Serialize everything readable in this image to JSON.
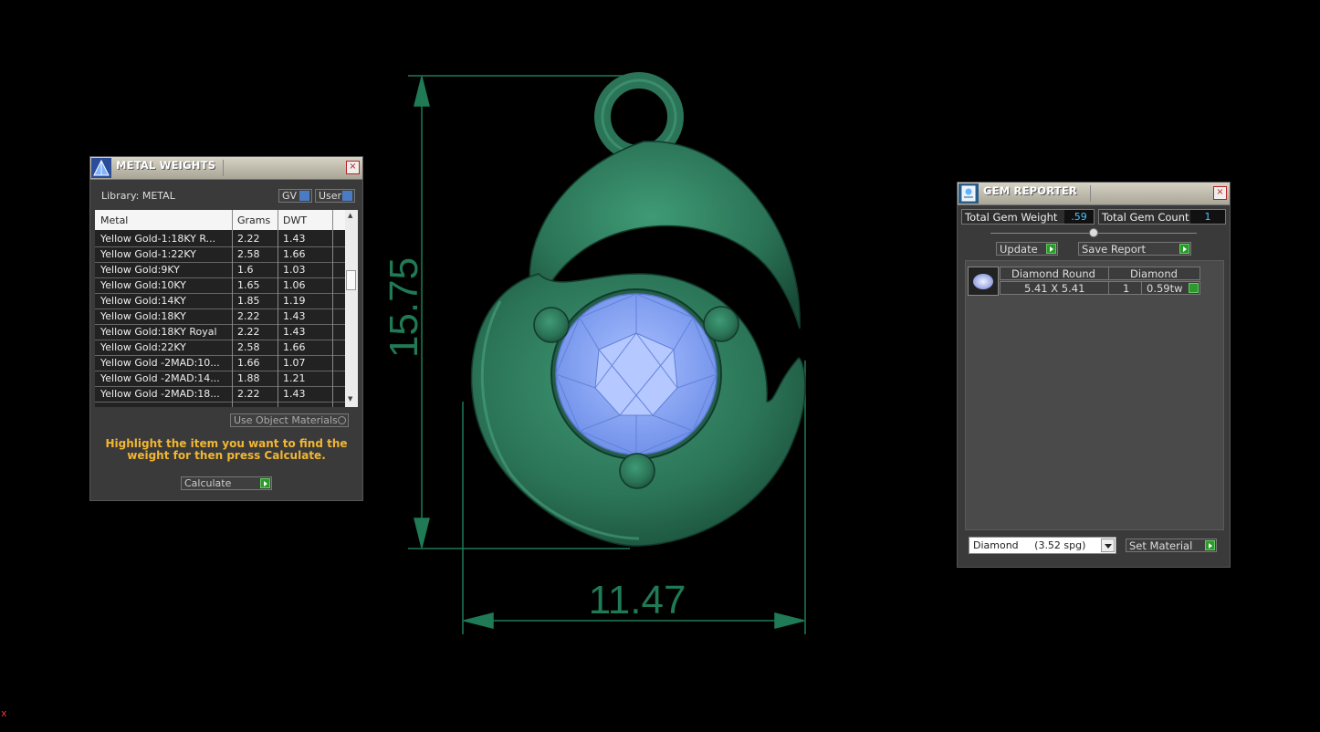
{
  "metal_weights": {
    "title": "METAL WEIGHTS",
    "close": "×",
    "library_label": "Library: METAL",
    "gv_label": "GV",
    "user_label": "User",
    "columns": [
      "Metal",
      "Grams",
      "DWT"
    ],
    "rows": [
      [
        "Yellow Gold-1:18KY R...",
        "2.22",
        "1.43"
      ],
      [
        "Yellow Gold-1:22KY",
        "2.58",
        "1.66"
      ],
      [
        "Yellow Gold:9KY",
        "1.6",
        "1.03"
      ],
      [
        "Yellow Gold:10KY",
        "1.65",
        "1.06"
      ],
      [
        "Yellow Gold:14KY",
        "1.85",
        "1.19"
      ],
      [
        "Yellow Gold:18KY",
        "2.22",
        "1.43"
      ],
      [
        "Yellow Gold:18KY Royal",
        "2.22",
        "1.43"
      ],
      [
        "Yellow Gold:22KY",
        "2.58",
        "1.66"
      ],
      [
        "Yellow Gold -2MAD:10...",
        "1.66",
        "1.07"
      ],
      [
        "Yellow Gold -2MAD:14...",
        "1.88",
        "1.21"
      ],
      [
        "Yellow Gold -2MAD:18...",
        "2.22",
        "1.43"
      ]
    ],
    "scroll_up": "▲",
    "scroll_down": "▼",
    "use_object_materials": "Use Object Materials",
    "instructions": "Highlight the item you want to find the weight for then press Calculate.",
    "calculate_label": "Calculate"
  },
  "gem_reporter": {
    "title": "GEM REPORTER",
    "close": "×",
    "total_weight_label": "Total Gem Weight",
    "total_weight_value": ".59",
    "total_count_label": "Total Gem Count",
    "total_count_value": "1",
    "update_label": "Update",
    "save_report_label": "Save Report",
    "gem_row": {
      "shape_name": "Diamond Round",
      "size": "5.41 X 5.41",
      "material": "Diamond",
      "count": "1",
      "weight": "0.59tw"
    },
    "material_select": "Diamond     (3.52 spg)",
    "set_material_label": "Set Material"
  },
  "viewport": {
    "height_dimension": "15.75",
    "width_dimension": "11.47",
    "dimension_color": "#1f7a55",
    "corner_marker": "x"
  },
  "colors": {
    "metal": "#2e7a5c",
    "gem": "#8aa6f2",
    "accent_text": "#f2b632",
    "go_button": "#2a9a2a"
  }
}
